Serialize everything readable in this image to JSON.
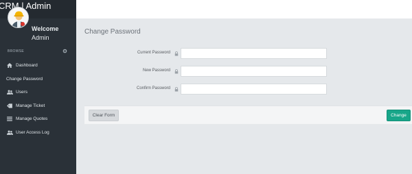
{
  "app": {
    "title": "CRM | Admin"
  },
  "profile": {
    "welcome": "Welcome",
    "name": "Admin",
    "section_label": "BROWSE"
  },
  "sidebar": {
    "items": [
      {
        "label": "Dashboard",
        "icon": "home-icon"
      },
      {
        "label": "Change Password",
        "icon": "none"
      },
      {
        "label": "Users",
        "icon": "users-icon"
      },
      {
        "label": "Manage Ticket",
        "icon": "tag-icon"
      },
      {
        "label": "Manage Quotes",
        "icon": "list-icon"
      },
      {
        "label": "User Access Log",
        "icon": "users-icon"
      }
    ]
  },
  "page": {
    "title": "Change Password"
  },
  "form": {
    "current_password": {
      "label": "Current Password",
      "value": "",
      "icon": "lock-icon"
    },
    "new_password": {
      "label": "New Password",
      "value": "",
      "icon": "lock-icon"
    },
    "confirm_password": {
      "label": "Confirm Password",
      "value": "",
      "icon": "lock-icon"
    }
  },
  "buttons": {
    "clear": "Clear Form",
    "change": "Change"
  },
  "colors": {
    "sidebar": "#2a3138",
    "accent": "#18a689",
    "content_bg": "#e5e8eb"
  }
}
